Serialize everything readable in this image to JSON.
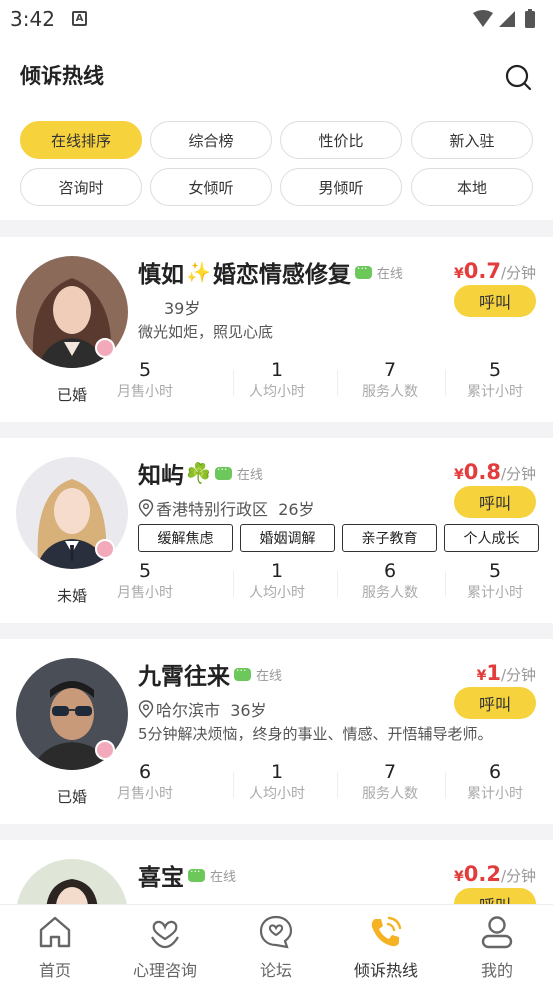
{
  "status_bar": {
    "time": "3:42",
    "notif_icon_letter": "A"
  },
  "header": {
    "title": "倾诉热线",
    "search_icon": "search-icon"
  },
  "filters": [
    "在线排序",
    "综合榜",
    "性价比",
    "新入驻",
    "咨询时",
    "女倾听",
    "男倾听",
    "本地"
  ],
  "active_filter": "在线排序",
  "online_text": "在线",
  "call_label": "呼叫",
  "currency": "¥",
  "price_unit": "/分钟",
  "stat_labels": [
    "月售小时",
    "人均小时",
    "服务人数",
    "累计小时"
  ],
  "colors": {
    "accent": "#f6d23d",
    "price": "#e33c3c",
    "online_dot": "#6cc85b"
  },
  "cards": [
    {
      "name": "慎如",
      "name_emoji": "✨",
      "name_second": "婚恋情感修复",
      "location": "",
      "age": "39岁",
      "intro": "微光如炬，照见心底",
      "price": "0.7",
      "marital": "已婚",
      "tags": [],
      "stats": [
        "5",
        "1",
        "7",
        "5"
      ]
    },
    {
      "name": "知屿",
      "name_emoji": "☘️",
      "name_second": "",
      "location": "香港特别行政区",
      "age": "26岁",
      "intro": "",
      "price": "0.8",
      "marital": "未婚",
      "tags": [
        "缓解焦虑",
        "婚姻调解",
        "亲子教育",
        "个人成长"
      ],
      "stats": [
        "5",
        "1",
        "6",
        "5"
      ]
    },
    {
      "name": "九霄往来",
      "name_emoji": "",
      "name_second": "",
      "location": "哈尔滨市",
      "age": "36岁",
      "intro": "5分钟解决烦恼，终身的事业、情感、开悟辅导老师。",
      "price": "1",
      "marital": "已婚",
      "tags": [],
      "stats": [
        "6",
        "1",
        "7",
        "6"
      ]
    },
    {
      "name": "喜宝",
      "name_emoji": "",
      "name_second": "",
      "location": "",
      "age": "",
      "intro": "",
      "price": "0.2",
      "marital": "",
      "tags": [],
      "stats": []
    }
  ],
  "tabs": [
    {
      "label": "首页",
      "icon": "home-icon"
    },
    {
      "label": "心理咨询",
      "icon": "heart-hand-icon"
    },
    {
      "label": "论坛",
      "icon": "heart-chat-icon"
    },
    {
      "label": "倾诉热线",
      "icon": "phone-call-icon"
    },
    {
      "label": "我的",
      "icon": "user-icon"
    }
  ],
  "active_tab": "倾诉热线"
}
